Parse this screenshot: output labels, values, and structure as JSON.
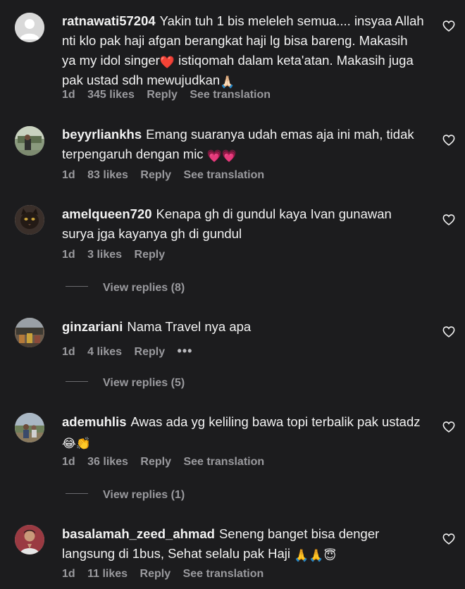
{
  "comments": [
    {
      "username": "ratnawati57204",
      "text": "Yakin tuh 1 bis meleleh semua.... insyaa Allah nti klo pak haji afgan berangkat haji lg bisa bareng. Makasih ya my idol singer",
      "emoji1": "❤️",
      "text2": " istiqomah dalam keta'atan. Makasih juga pak ustad sdh mewujudkan",
      "emoji2": "🙏🏻",
      "time": "1d",
      "likes": "345 likes",
      "reply": "Reply",
      "translation": "See translation",
      "avatar": "default-avatar"
    },
    {
      "username": "beyyrliankhs",
      "text": "Emang suaranya udah emas aja ini mah, tidak terpengaruh dengan mic ",
      "emoji": "💗💗",
      "time": "1d",
      "likes": "83 likes",
      "reply": "Reply",
      "translation": "See translation",
      "avatar": "photo-avatar"
    },
    {
      "username": "amelqueen720",
      "text": "Kenapa gh di gundul kaya Ivan gunawan surya jga kayanya gh di gundul",
      "time": "1d",
      "likes": "3 likes",
      "reply": "Reply",
      "view_replies": "View replies (8)",
      "avatar": "cat-avatar"
    },
    {
      "username": "ginzariani",
      "text": "Nama Travel nya apa",
      "time": "1d",
      "likes": "4 likes",
      "reply": "Reply",
      "more": "•••",
      "view_replies": "View replies (5)",
      "avatar": "photo-avatar"
    },
    {
      "username": "ademuhlis",
      "text": "Awas ada yg keliling bawa topi terbalik pak ustadz",
      "emoji": "😂👏",
      "time": "1d",
      "likes": "36 likes",
      "reply": "Reply",
      "translation": "See translation",
      "view_replies": "View replies (1)",
      "avatar": "photo-avatar"
    },
    {
      "username": "basalamah_zeed_ahmad",
      "text": "Seneng banget bisa denger langsung di 1bus, Sehat selalu pak Haji ",
      "emoji": "🙏🙏😇",
      "time": "1d",
      "likes": "11 likes",
      "reply": "Reply",
      "translation": "See translation",
      "avatar": "person-avatar"
    }
  ],
  "colors": {
    "background": "#1c1c1e",
    "text": "#f2f2f2",
    "secondary": "#9a9a9e"
  }
}
